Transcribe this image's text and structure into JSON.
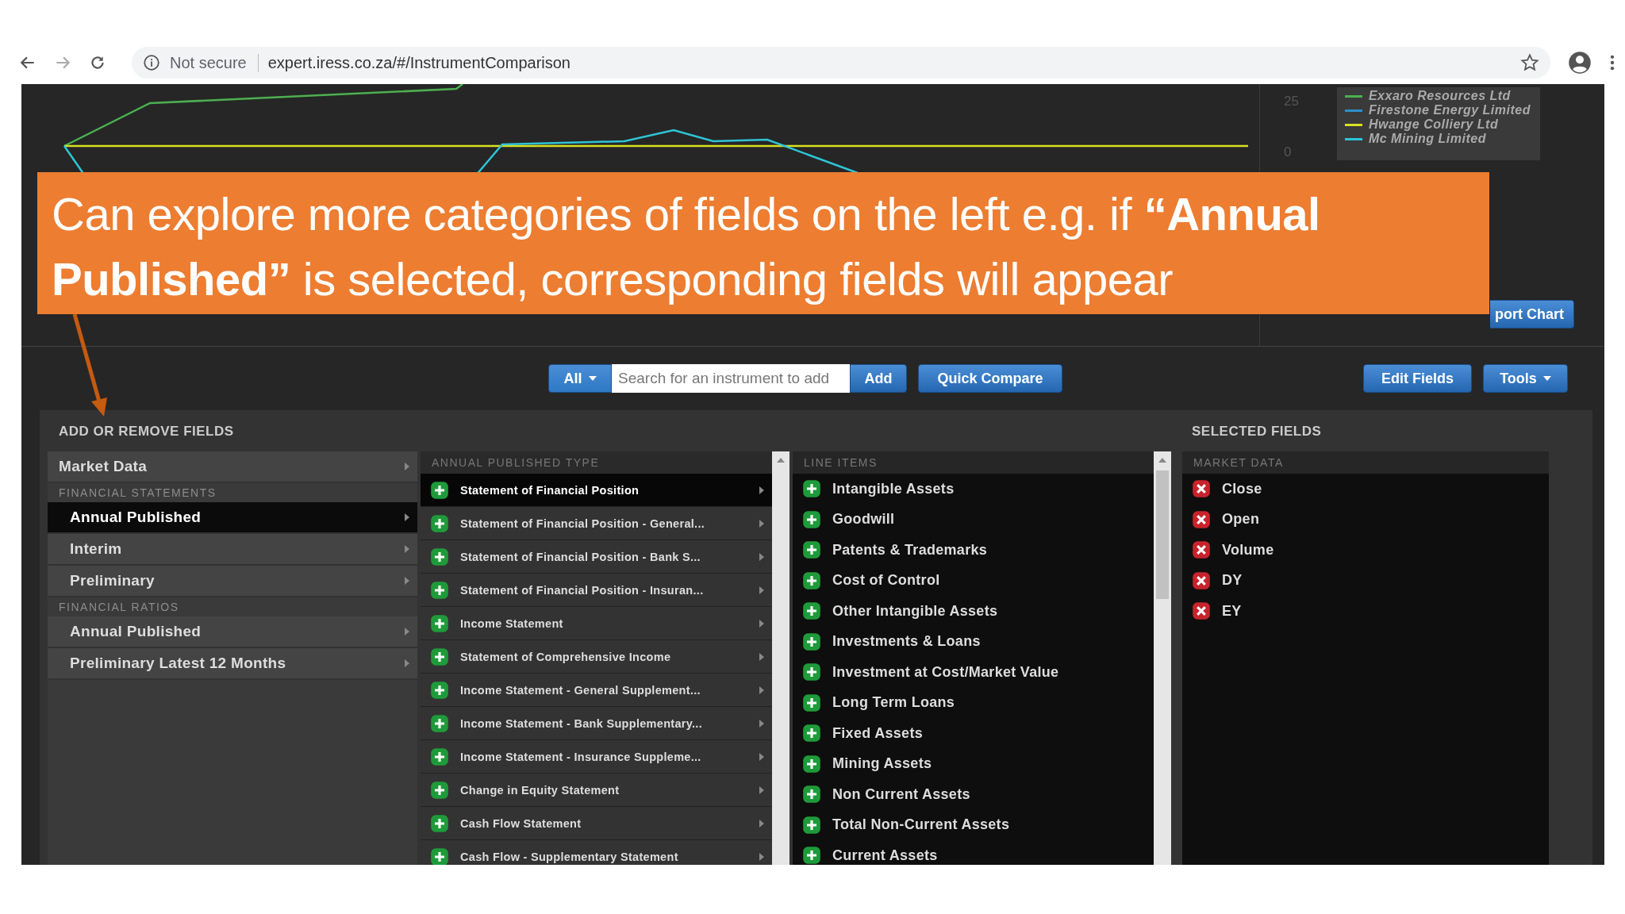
{
  "browser": {
    "security": "Not secure",
    "url": "expert.iress.co.za/#/InstrumentComparison"
  },
  "chart": {
    "axis_labels": [
      "25",
      "0"
    ],
    "legend": [
      {
        "name": "Exxaro Resources Ltd",
        "color": "#4caf50"
      },
      {
        "name": "Firestone Energy Limited",
        "color": "#2f8fc9"
      },
      {
        "name": "Hwange Colliery Ltd",
        "color": "#d9e021"
      },
      {
        "name": "Mc Mining Limited",
        "color": "#2ec4d6"
      }
    ],
    "export_button": "port Chart"
  },
  "callout": {
    "text": "Can explore more categories of fields on the left e.g. if **“Annual Published”** is selected, corresponding fields will appear"
  },
  "toolbar": {
    "filter": "All",
    "search": {
      "placeholder": "Search for an instrument to add"
    },
    "add": "Add",
    "quick_compare": "Quick Compare",
    "edit_fields": "Edit Fields",
    "tools": "Tools"
  },
  "fields": {
    "title": "ADD OR REMOVE FIELDS",
    "selected_title": "SELECTED FIELDS",
    "menu": [
      {
        "kind": "item",
        "label": "Market Data",
        "selected": false
      },
      {
        "kind": "header",
        "label": "FINANCIAL STATEMENTS"
      },
      {
        "kind": "subitem",
        "label": "Annual Published",
        "selected": true
      },
      {
        "kind": "subitem",
        "label": "Interim",
        "selected": false
      },
      {
        "kind": "subitem",
        "label": "Preliminary",
        "selected": false
      },
      {
        "kind": "header",
        "label": "FINANCIAL RATIOS"
      },
      {
        "kind": "subitem",
        "label": "Annual Published",
        "selected": false
      },
      {
        "kind": "subitem",
        "label": "Preliminary Latest 12 Months",
        "selected": false
      }
    ],
    "types": {
      "header": "ANNUAL PUBLISHED TYPE",
      "items": [
        {
          "label": "Statement of Financial Position",
          "selected": true
        },
        {
          "label": "Statement of Financial Position - General...",
          "selected": false
        },
        {
          "label": "Statement of Financial Position - Bank S...",
          "selected": false
        },
        {
          "label": "Statement of Financial Position - Insuran...",
          "selected": false
        },
        {
          "label": "Income Statement",
          "selected": false
        },
        {
          "label": "Statement of Comprehensive Income",
          "selected": false
        },
        {
          "label": "Income Statement - General Supplement...",
          "selected": false
        },
        {
          "label": "Income Statement - Bank Supplementary...",
          "selected": false
        },
        {
          "label": "Income Statement - Insurance Suppleme...",
          "selected": false
        },
        {
          "label": "Change in Equity Statement",
          "selected": false
        },
        {
          "label": "Cash Flow Statement",
          "selected": false
        },
        {
          "label": "Cash Flow - Supplementary Statement",
          "selected": false
        }
      ]
    },
    "line_items": {
      "header": "LINE ITEMS",
      "items": [
        "Intangible Assets",
        "Goodwill",
        "Patents & Trademarks",
        "Cost of Control",
        "Other Intangible Assets",
        "Investments & Loans",
        "Investment at Cost/Market Value",
        "Long Term Loans",
        "Fixed Assets",
        "Mining Assets",
        "Non Current Assets",
        "Total Non-Current Assets",
        "Current Assets"
      ]
    },
    "selected": {
      "header": "MARKET DATA",
      "items": [
        "Close",
        "Open",
        "Volume",
        "DY",
        "EY"
      ]
    }
  }
}
